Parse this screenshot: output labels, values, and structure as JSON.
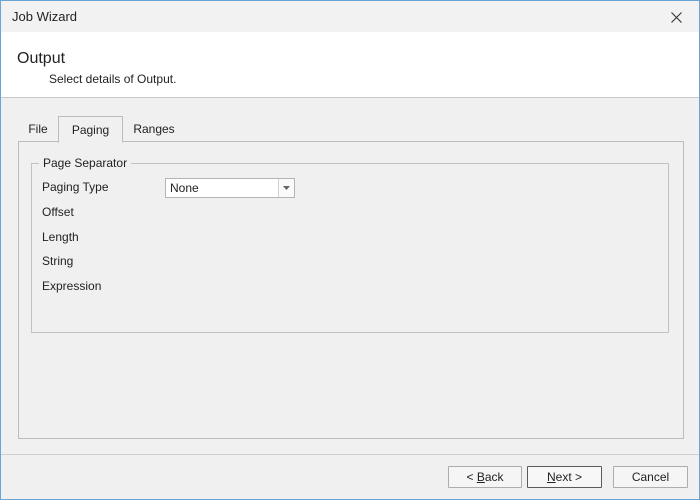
{
  "window": {
    "title": "Job Wizard"
  },
  "header": {
    "title": "Output",
    "subtitle": "Select details of Output."
  },
  "tabs": [
    {
      "label": "File",
      "active": false
    },
    {
      "label": "Paging",
      "active": true
    },
    {
      "label": "Ranges",
      "active": false
    }
  ],
  "group": {
    "legend": "Page Separator",
    "fields": {
      "paging_type": "Paging Type",
      "offset": "Offset",
      "length": "Length",
      "string": "String",
      "expression": "Expression"
    },
    "paging_type_value": "None"
  },
  "buttons": {
    "back_prefix": "< ",
    "back_mnemonic": "B",
    "back_rest": "ack",
    "next_mnemonic": "N",
    "next_rest": "ext >",
    "cancel": "Cancel"
  },
  "icons": {
    "close": "close-icon",
    "dropdown": "chevron-down-icon"
  }
}
